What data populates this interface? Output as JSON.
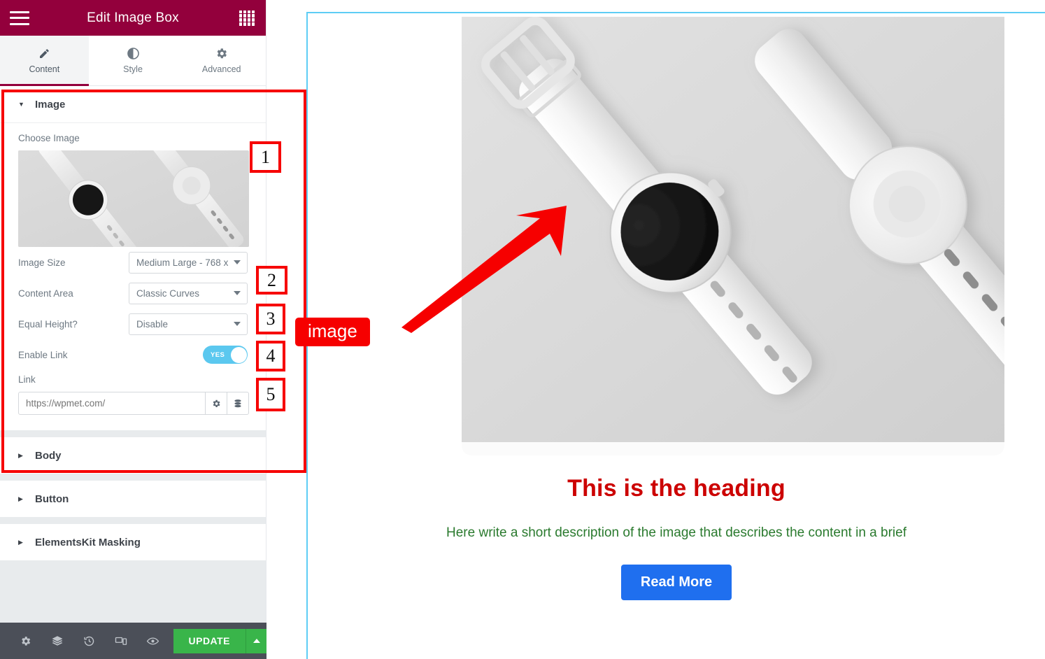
{
  "panel": {
    "title": "Edit Image Box",
    "menu_icon": "hamburger-icon",
    "grid_icon": "widgets-grid-icon",
    "tabs": [
      {
        "label": "Content",
        "icon": "pencil-icon",
        "active": true
      },
      {
        "label": "Style",
        "icon": "contrast-icon",
        "active": false
      },
      {
        "label": "Advanced",
        "icon": "gear-icon",
        "active": false
      }
    ],
    "sections": [
      {
        "label": "Image",
        "expanded": true
      },
      {
        "label": "Body",
        "expanded": false
      },
      {
        "label": "Button",
        "expanded": false
      },
      {
        "label": "ElementsKit Masking",
        "expanded": false
      }
    ],
    "image_section": {
      "choose_image_label": "Choose Image",
      "image_size": {
        "label": "Image Size",
        "value": "Medium Large - 768 x"
      },
      "content_area": {
        "label": "Content Area",
        "value": "Classic Curves"
      },
      "equal_height": {
        "label": "Equal Height?",
        "value": "Disable"
      },
      "enable_link": {
        "label": "Enable Link",
        "toggle_text": "YES",
        "state": "on"
      },
      "link": {
        "label": "Link",
        "placeholder": "https://wpmet.com/",
        "value": "",
        "settings_icon": "gear-icon",
        "dynamic_icon": "dynamic-tags-icon"
      }
    },
    "footer": {
      "icons": [
        "settings-gear-icon",
        "navigator-layers-icon",
        "history-clock-icon",
        "responsive-device-icon",
        "preview-eye-icon"
      ],
      "update_label": "UPDATE",
      "update_caret_icon": "caret-up-icon"
    }
  },
  "preview": {
    "heading": "This is the heading",
    "description": "Here write a short description of the image that describes the content in a brief",
    "button_label": "Read More",
    "image_alt": "two white smartwatches on light gray background"
  },
  "annotations": {
    "callout_label": "image",
    "numbers": [
      "1",
      "2",
      "3",
      "4",
      "5"
    ]
  },
  "colors": {
    "brand": "#93003c",
    "heading": "#cc0000",
    "description": "#2a7a2e",
    "button": "#1f6fef",
    "toggle_on": "#5bc8ef",
    "update": "#39b54a",
    "annotation": "#f60000",
    "frame": "#5ecdf5"
  }
}
